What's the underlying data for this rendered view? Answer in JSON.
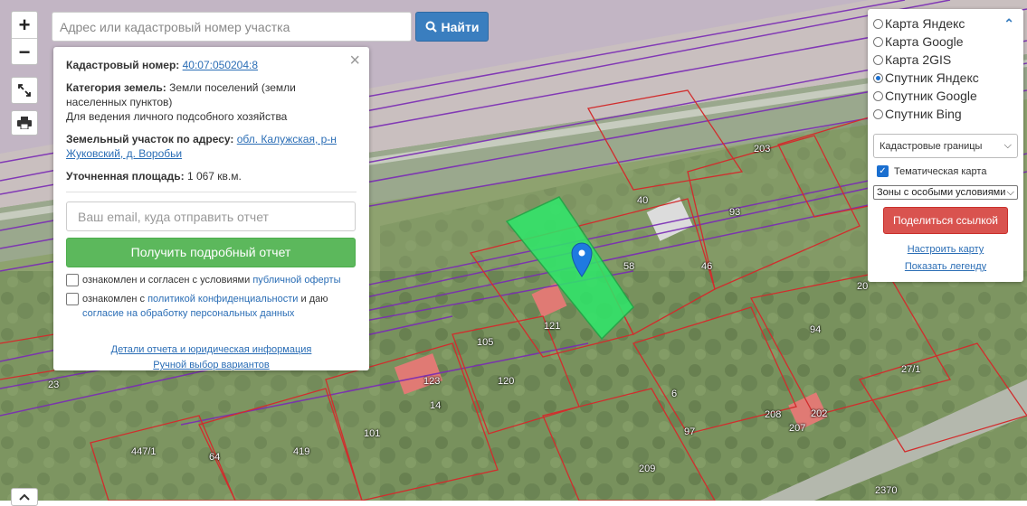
{
  "search": {
    "placeholder": "Адрес или кадастровый номер участка",
    "button_label": "Найти"
  },
  "zoom": {
    "in_label": "+",
    "out_label": "−"
  },
  "info_panel": {
    "cadastral_label": "Кадастровый номер:",
    "cadastral_number": "40:07:050204:8",
    "category_label": "Категория земель:",
    "category_value": "Земли поселений (земли населенных пунктов)",
    "usage": "Для ведения личного подсобного хозяйства",
    "address_label": "Земельный участок по адресу:",
    "address_value": "обл. Калужская, р-н Жуковский, д. Воробьи",
    "area_label": "Уточненная площадь:",
    "area_value": "1 067 кв.м.",
    "email_placeholder": "Ваш email, куда отправить отчет",
    "report_button": "Получить подробный отчет",
    "agree1_text": "ознакомлен и согласен с условиями ",
    "agree1_link": "публичной оферты",
    "agree2_text1": "ознакомлен с ",
    "agree2_link1": "политикой конфиденциальности",
    "agree2_text2": " и даю ",
    "agree2_link2": "согласие на обработку персональных данных",
    "details_link": "Детали отчета и юридическая информация",
    "manual_link": "Ручной выбор вариантов"
  },
  "layers_panel": {
    "base_maps": [
      {
        "label": "Карта Яндекс",
        "selected": false
      },
      {
        "label": "Карта Google",
        "selected": false
      },
      {
        "label": "Карта 2GIS",
        "selected": false
      },
      {
        "label": "Спутник Яндекс",
        "selected": true
      },
      {
        "label": "Спутник Google",
        "selected": false
      },
      {
        "label": "Спутник Bing",
        "selected": false
      }
    ],
    "boundaries_select": "Кадастровые границы",
    "thematic_label": "Тематическая карта",
    "thematic_checked": true,
    "zones_select": "Зоны с особыми условиями",
    "share_button": "Поделиться ссылкой",
    "configure_link": "Настроить карту",
    "legend_link": "Показать легенду"
  },
  "map": {
    "parcel_labels": [
      "40",
      "93",
      "203",
      "58",
      "46",
      "94",
      "20",
      "105",
      "120",
      "121",
      "209",
      "123",
      "14",
      "6",
      "97",
      "208",
      "207",
      "202",
      "27/1",
      "101",
      "419",
      "64",
      "447/1",
      "2370",
      "23"
    ],
    "colors": {
      "selected_parcel": "#2ee86a",
      "boundary": "#d12d2d",
      "zone": "#7a2bb5",
      "marker": "#1f7ae0"
    }
  }
}
